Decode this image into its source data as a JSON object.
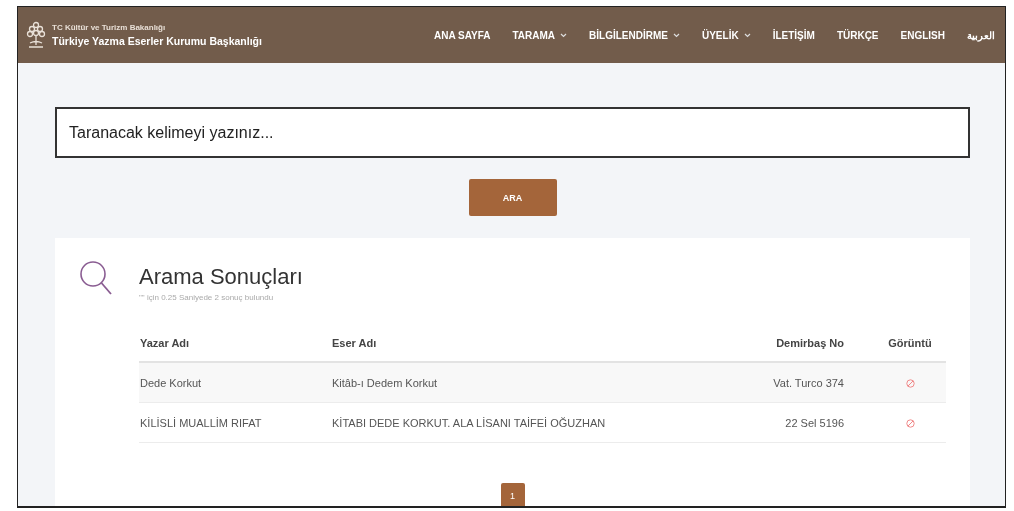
{
  "header": {
    "ministry": "TC Kültür ve Turizm Bakanlığı",
    "title": "Türkiye Yazma Eserler Kurumu Başkanlığı",
    "nav": [
      {
        "label": "ANA SAYFA",
        "dropdown": false
      },
      {
        "label": "TARAMA",
        "dropdown": true
      },
      {
        "label": "BİLGİLENDİRME",
        "dropdown": true
      },
      {
        "label": "ÜYELİK",
        "dropdown": true
      },
      {
        "label": "İLETİŞİM",
        "dropdown": false
      },
      {
        "label": "TÜRKÇE",
        "dropdown": false
      },
      {
        "label": "ENGLISH",
        "dropdown": false
      },
      {
        "label": "العربية",
        "dropdown": false
      }
    ]
  },
  "search": {
    "placeholder": "Taranacak kelimeyi yazınız...",
    "button": "ARA"
  },
  "results": {
    "title": "Arama Sonuçları",
    "summary": "\"\" için 0.25 Saniyede 2 sonuç bulundu",
    "columns": [
      "Yazar Adı",
      "Eser Adı",
      "Demirbaş No",
      "Görüntü"
    ],
    "rows": [
      {
        "author": "Dede Korkut",
        "work": "Kitâb-ı Dedem Korkut",
        "number": "Vat. Turco 374"
      },
      {
        "author": "KİLİSLİ MUALLİM RIFAT",
        "work": "KİTABI DEDE KORKUT. ALA LİSANI TAİFEİ OĞUZHAN",
        "number": "22 Sel 5196"
      }
    ],
    "pages": [
      {
        "label": "1",
        "selected": true
      }
    ]
  }
}
